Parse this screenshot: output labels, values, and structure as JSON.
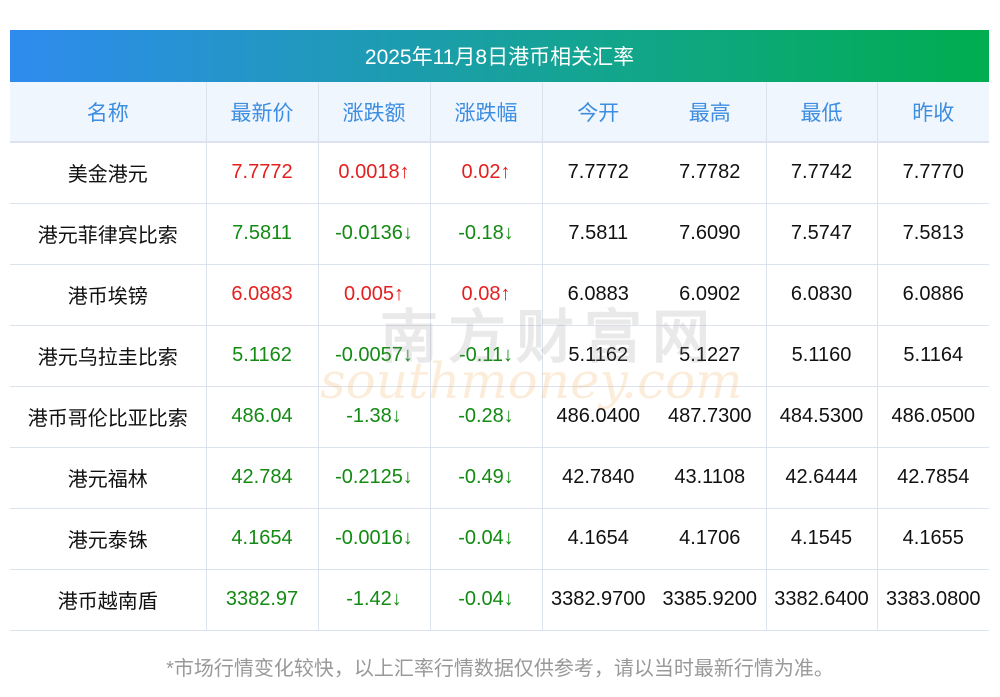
{
  "title": "2025年11月8日港币相关汇率",
  "headers": [
    "名称",
    "最新价",
    "涨跌额",
    "涨跌幅",
    "今开",
    "最高",
    "最低",
    "昨收"
  ],
  "rows": [
    {
      "name": "美金港元",
      "last": "7.7772",
      "chg": "0.0018↑",
      "pct": "0.02↑",
      "open": "7.7772",
      "high": "7.7782",
      "low": "7.7742",
      "prev": "7.7770",
      "dir": "up"
    },
    {
      "name": "港元菲律宾比索",
      "last": "7.5811",
      "chg": "-0.0136↓",
      "pct": "-0.18↓",
      "open": "7.5811",
      "high": "7.6090",
      "low": "7.5747",
      "prev": "7.5813",
      "dir": "down"
    },
    {
      "name": "港币埃镑",
      "last": "6.0883",
      "chg": "0.005↑",
      "pct": "0.08↑",
      "open": "6.0883",
      "high": "6.0902",
      "low": "6.0830",
      "prev": "6.0886",
      "dir": "up"
    },
    {
      "name": "港元乌拉圭比索",
      "last": "5.1162",
      "chg": "-0.0057↓",
      "pct": "-0.11↓",
      "open": "5.1162",
      "high": "5.1227",
      "low": "5.1160",
      "prev": "5.1164",
      "dir": "down"
    },
    {
      "name": "港币哥伦比亚比索",
      "last": "486.04",
      "chg": "-1.38↓",
      "pct": "-0.28↓",
      "open": "486.0400",
      "high": "487.7300",
      "low": "484.5300",
      "prev": "486.0500",
      "dir": "down"
    },
    {
      "name": "港元福林",
      "last": "42.784",
      "chg": "-0.2125↓",
      "pct": "-0.49↓",
      "open": "42.7840",
      "high": "43.1108",
      "low": "42.6444",
      "prev": "42.7854",
      "dir": "down"
    },
    {
      "name": "港元泰铢",
      "last": "4.1654",
      "chg": "-0.0016↓",
      "pct": "-0.04↓",
      "open": "4.1654",
      "high": "4.1706",
      "low": "4.1545",
      "prev": "4.1655",
      "dir": "down"
    },
    {
      "name": "港币越南盾",
      "last": "3382.97",
      "chg": "-1.42↓",
      "pct": "-0.04↓",
      "open": "3382.9700",
      "high": "3385.9200",
      "low": "3382.6400",
      "prev": "3383.0800",
      "dir": "down"
    }
  ],
  "note": "*市场行情变化较快，以上汇率行情数据仅供参考，请以当时最新行情为准。",
  "watermark": {
    "cn": "南方财富网",
    "en": "southmoney.com"
  },
  "colors": {
    "up": "#e41f1f",
    "down": "#138a13",
    "header_text": "#3d8de0"
  }
}
